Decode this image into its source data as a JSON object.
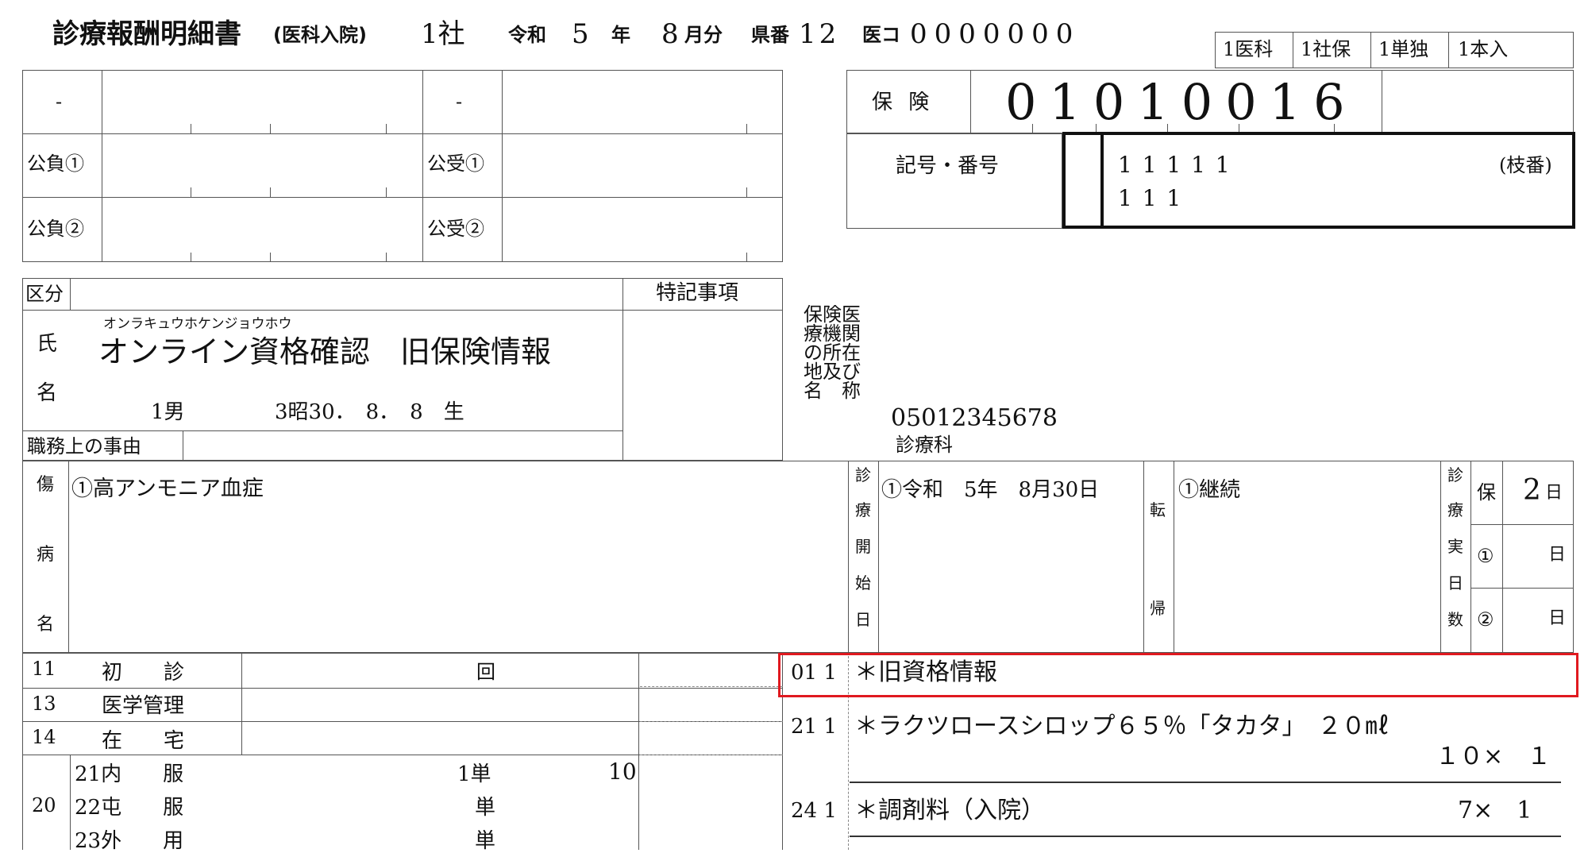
{
  "header": {
    "title": "診療報酬明細書",
    "subtitle": "(医科入院)",
    "insurer_type": "1社",
    "era_label": "令和",
    "year": "5",
    "year_label": "年",
    "month": "8",
    "month_label": "月分",
    "pref_label": "県番",
    "pref_no": "12",
    "inst_label": "医コ",
    "inst_code": "0000000",
    "tags": [
      "1医科",
      "1社保",
      "1単独",
      "1本入"
    ]
  },
  "public": {
    "dash1": "-",
    "dash2": "-",
    "futan1": "公負①",
    "juku1": "公受①",
    "futan2": "公負②",
    "juku2": "公受②"
  },
  "insurance": {
    "label": "保 険",
    "number": "01010016",
    "kigo_label": "記号・番号",
    "kigo_line1": "1 1 1 1 1",
    "kigo_line2": "1 1 1",
    "edaban": "(枝番)"
  },
  "patient": {
    "kubun_label": "区分",
    "tokki_label": "特記事項",
    "name_label_1": "氏",
    "name_label_2": "名",
    "kana": "オンラキュウホケンジョウホウ",
    "name": "オンライン資格確認　旧保険情報",
    "sex": "1男",
    "birth": "3昭30．　8．　8　生",
    "shokumu_label": "職務上の事由"
  },
  "facility": {
    "label_lines": [
      "保険医",
      "療機関",
      "の所在",
      "地及び",
      "名　称"
    ],
    "phone": "05012345678",
    "dept": "診療科"
  },
  "disease": {
    "label_chars": [
      "傷",
      "病",
      "名"
    ],
    "name": "①高アンモニア血症",
    "start_label_chars": [
      "診",
      "療",
      "開",
      "始",
      "日"
    ],
    "start_date": "①令和　5年　8月30日",
    "outcome_label_top": "転",
    "outcome_label_bottom": "帰",
    "outcome": "①継続",
    "days_label_chars": [
      "診",
      "療",
      "実",
      "日",
      "数"
    ],
    "days_rows": [
      {
        "label": "保",
        "value": "2",
        "unit": "日"
      },
      {
        "label": "①",
        "value": "",
        "unit": "日"
      },
      {
        "label": "②",
        "value": "",
        "unit": "日"
      }
    ]
  },
  "services": [
    {
      "code": "11",
      "name": "初　　診",
      "unit": "回",
      "count": ""
    },
    {
      "code": "13",
      "name": "医学管理",
      "unit": "",
      "count": ""
    },
    {
      "code": "14",
      "name": "在　　宅",
      "unit": "",
      "count": ""
    }
  ],
  "medication": {
    "code": "20",
    "rows": [
      {
        "name": "21内　　服",
        "unit": "1単",
        "count": "10"
      },
      {
        "name": "22屯　　服",
        "unit": "単",
        "count": ""
      },
      {
        "name": "23外　　用",
        "unit": "単",
        "count": ""
      }
    ]
  },
  "details": [
    {
      "code": "01 1",
      "text": "＊旧資格情報",
      "sub": "",
      "highlighted": true
    },
    {
      "code": "21 1",
      "text": "＊ラクツロースシロップ６５％「タカタ」　２０㎖",
      "sub": "１０×　１",
      "highlighted": false
    },
    {
      "code": "24 1",
      "text": "＊調剤料（入院）",
      "sub": "7×　1",
      "highlighted": false
    }
  ],
  "colors": {
    "highlight": "#e0191f",
    "line": "#555555"
  }
}
